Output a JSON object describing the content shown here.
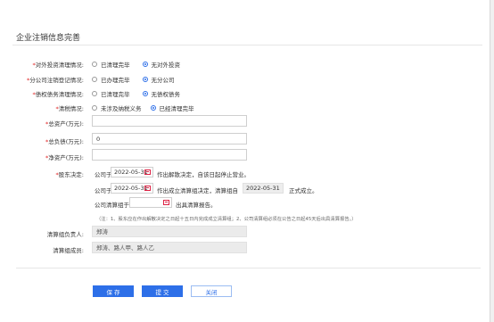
{
  "title": "企业注销信息完善",
  "labels": {
    "foreign_invest": "对外投资清理情况:",
    "branch": "分公司注销登记情况:",
    "debt": "债权债务清理情况:",
    "tax": "清税情况:",
    "total_assets": "总资产(万元):",
    "total_liabilities": "总负债(万元):",
    "net_assets": "净资产(万元):",
    "shareholder_decision": "股东决定:",
    "leader": "清算组负责人:",
    "members": "清算组成员:"
  },
  "radios": {
    "foreign_invest": [
      {
        "label": "已清理完毕",
        "selected": false
      },
      {
        "label": "无对外投资",
        "selected": true
      }
    ],
    "branch": [
      {
        "label": "已办理完毕",
        "selected": false
      },
      {
        "label": "无分公司",
        "selected": true
      }
    ],
    "debt": [
      {
        "label": "已清理完毕",
        "selected": false
      },
      {
        "label": "无债权债务",
        "selected": true
      }
    ],
    "tax": [
      {
        "label": "未涉及纳税义务",
        "selected": false
      },
      {
        "label": "已经清理完毕",
        "selected": true
      }
    ]
  },
  "inputs": {
    "total_assets": "",
    "total_liabilities": "0",
    "net_assets": ""
  },
  "decision": {
    "line1_prefix": "公司于",
    "line1_date": "2022-05-31",
    "line1_suffix": "作出解散决定，自该日起停止营业。",
    "line2_prefix": "公司于",
    "line2_date": "2022-05-31",
    "line2_mid": "作出成立清算组决定，清算组自",
    "line2_date2": "2022-05-31",
    "line2_suffix": "正式成立。",
    "line3_prefix": "公司清算组于",
    "line3_date": "",
    "line3_suffix": "出具清算报告。",
    "note": "（注：1、股东应在作出解散决定之日起十五日内完成成立清算组；2、公司清算组必须在公告之日起45天后出具清算报告。）"
  },
  "leader_value": "郑涛",
  "members_value": "郑涛、路人甲、路人乙",
  "buttons": {
    "save": "保 存",
    "submit": "提 交",
    "close": "关闭"
  }
}
